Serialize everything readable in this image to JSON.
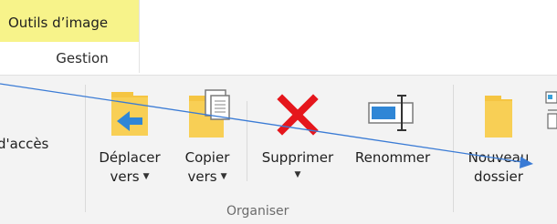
{
  "contextual_tab": {
    "title": "Outils d’image",
    "highlight_color": "#f7f38a"
  },
  "tabs": [
    {
      "label": "Gestion"
    }
  ],
  "ribbon": {
    "cut_label": "d'accès",
    "groups": [
      {
        "label": "Organiser",
        "buttons": [
          {
            "line1": "Déplacer",
            "line2": "vers",
            "icon": "move-to-folder-icon",
            "dropdown": true
          },
          {
            "line1": "Copier",
            "line2": "vers",
            "icon": "copy-to-folder-icon",
            "dropdown": true
          },
          {
            "line1": "Supprimer",
            "icon": "delete-x-icon",
            "dropdown": true
          },
          {
            "line1": "Renommer",
            "icon": "rename-icon",
            "dropdown": false
          }
        ]
      }
    ],
    "new_folder": {
      "line1": "Nouveau",
      "line2": "dossier",
      "icon": "new-folder-icon"
    }
  },
  "colors": {
    "folder": "#f5c542",
    "arrow_blue": "#2f86d6",
    "delete_red": "#e5161c",
    "annotation_line": "#3a7bd5"
  }
}
